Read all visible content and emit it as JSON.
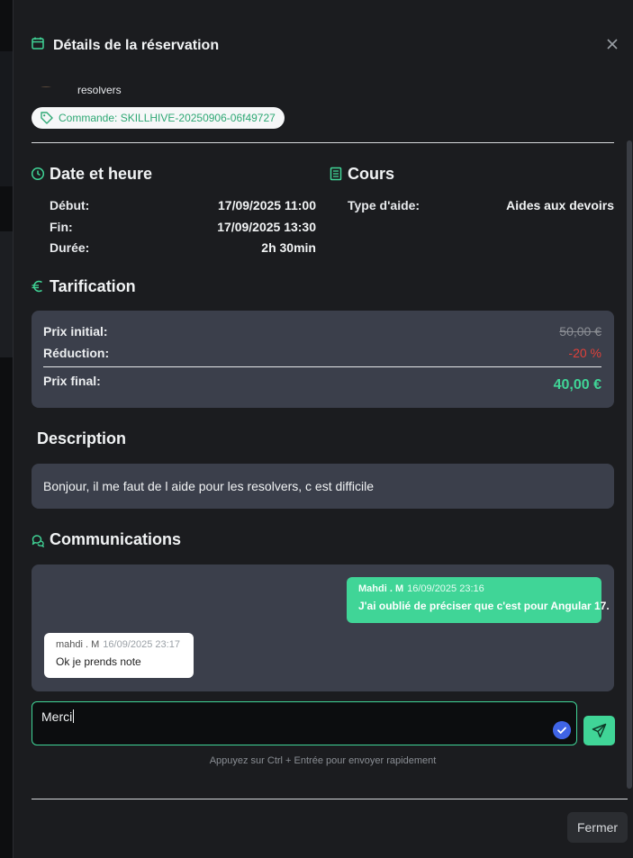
{
  "modal": {
    "title": "Détails de la réservation",
    "close_icon": "close-icon"
  },
  "partner": {
    "name": "resolvers"
  },
  "order": {
    "label": "Commande: SKILLHIVE-20250906-06f49727"
  },
  "date_section": {
    "title": "Date et heure",
    "rows": [
      {
        "label": "Début:",
        "value": "17/09/2025 11:00"
      },
      {
        "label": "Fin:",
        "value": "17/09/2025 13:30"
      },
      {
        "label": "Durée:",
        "value": "2h 30min"
      }
    ]
  },
  "course_section": {
    "title": "Cours",
    "rows": [
      {
        "label": "Type d'aide:",
        "value": "Aides aux devoirs"
      }
    ]
  },
  "pricing": {
    "title": "Tarification",
    "initial_label": "Prix initial:",
    "initial_value": "50,00 €",
    "discount_label": "Réduction:",
    "discount_value": "-20 %",
    "final_label": "Prix final:",
    "final_value": "40,00 €"
  },
  "description": {
    "title": "Description",
    "text": "Bonjour, il me faut de l aide pour les resolvers, c est difficile"
  },
  "communications": {
    "title": "Communications",
    "messages": [
      {
        "author": "Mahdi . M",
        "time": "16/09/2025 23:16",
        "text": "J'ai oublié de préciser que c'est pour Angular 17.",
        "direction": "outgoing"
      },
      {
        "author": "mahdi . M",
        "time": "16/09/2025 23:17",
        "text": "Ok je prends note",
        "direction": "incoming"
      }
    ],
    "input_value": "Merci",
    "hint": "Appuyez sur Ctrl + Entrée pour envoyer rapidement"
  },
  "footer": {
    "close_label": "Fermer"
  },
  "colors": {
    "accent": "#40d597",
    "discount": "#e0403a",
    "card": "#3b3f4b",
    "background": "#1b1c1f"
  }
}
